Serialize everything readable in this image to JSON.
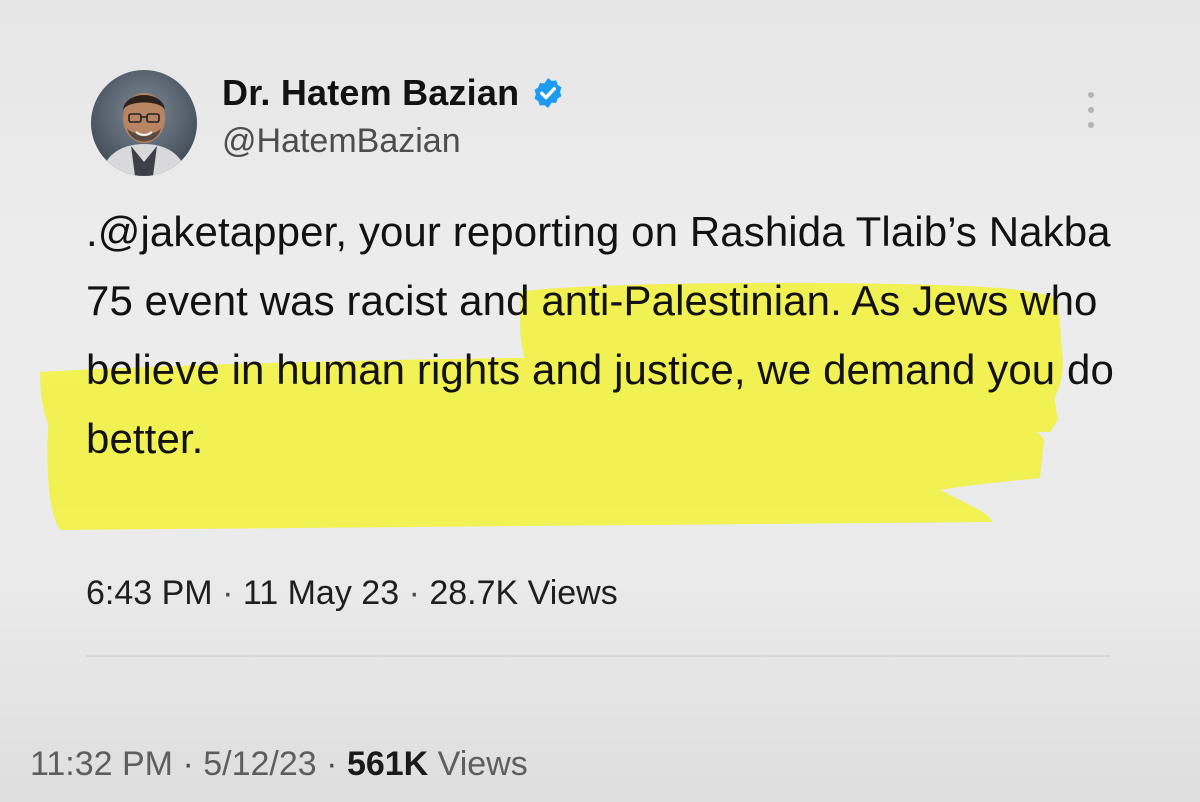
{
  "tweet": {
    "author": {
      "display_name": "Dr. Hatem Bazian",
      "handle": "@HatemBazian",
      "verified": true
    },
    "text": ".@jaketapper, your reporting on Rashida Tlaib’s Nakba 75 event was racist and anti-Palestinian. As Jews who believe in human rights and justice, we demand you do better.",
    "time": "6:43 PM",
    "date": "11 May 23",
    "views_count": "28.7K",
    "views_label": "Views",
    "separator": "·"
  },
  "footer": {
    "time": "11:32 PM",
    "date": "5/12/23",
    "views_count": "561K",
    "views_label": "Views",
    "separator": "·"
  },
  "colors": {
    "highlight": "#f3f33a",
    "verified_badge": "#1d9bf0",
    "background": "#ebebeb"
  },
  "icons": {
    "verified": "verified-badge-icon",
    "more": "more-options-icon"
  }
}
